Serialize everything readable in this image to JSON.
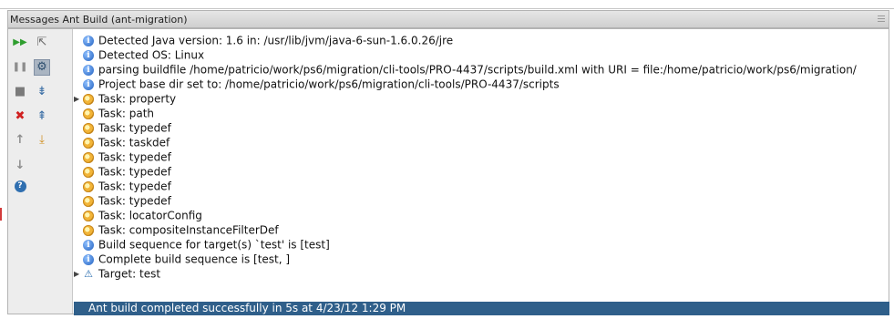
{
  "window": {
    "title": "Messages Ant Build (ant-migration)"
  },
  "toolbar": {
    "buttons": [
      {
        "name": "rerun-icon",
        "glyph": "▶▶",
        "color": "#2f9e2f"
      },
      {
        "name": "collapse-icon",
        "glyph": "⇱",
        "color": "#6b6b6b"
      },
      {
        "name": "pause-icon",
        "glyph": "❚❚",
        "color": "#8d8d8d"
      },
      {
        "name": "filter-icon",
        "glyph": "⚙",
        "color": "#2f4f6f"
      },
      {
        "name": "stop-icon",
        "glyph": "■",
        "color": "#7a7a7a"
      },
      {
        "name": "expand-all-icon",
        "glyph": "⇟",
        "color": "#3a6ea5"
      },
      {
        "name": "close-icon",
        "glyph": "✖",
        "color": "#d02020"
      },
      {
        "name": "collapse-all-icon",
        "glyph": "⇞",
        "color": "#3a6ea5"
      },
      {
        "name": "up-arrow-icon",
        "glyph": "↑",
        "color": "#8d8d8d"
      },
      {
        "name": "export-icon",
        "glyph": "⤓",
        "color": "#d08f20"
      },
      {
        "name": "down-arrow-icon",
        "glyph": "↓",
        "color": "#8d8d8d"
      },
      {
        "name": "help-icon",
        "glyph": "?",
        "color": "#2f6fb0"
      }
    ]
  },
  "messages": [
    {
      "type": "info",
      "text": "Detected Java version: 1.6 in: /usr/lib/jvm/java-6-sun-1.6.0.26/jre"
    },
    {
      "type": "info",
      "text": "Detected OS: Linux"
    },
    {
      "type": "info",
      "text": "parsing buildfile /home/patricio/work/ps6/migration/cli-tools/PRO-4437/scripts/build.xml with URI = file:/home/patricio/work/ps6/migration/"
    },
    {
      "type": "info",
      "text": "Project base dir set to: /home/patricio/work/ps6/migration/cli-tools/PRO-4437/scripts"
    },
    {
      "type": "task",
      "text": "Task: property",
      "expandable": true
    },
    {
      "type": "task",
      "text": "Task: path"
    },
    {
      "type": "task",
      "text": "Task: typedef"
    },
    {
      "type": "task",
      "text": "Task: taskdef"
    },
    {
      "type": "task",
      "text": "Task: typedef"
    },
    {
      "type": "task",
      "text": "Task: typedef"
    },
    {
      "type": "task",
      "text": "Task: typedef"
    },
    {
      "type": "task",
      "text": "Task: typedef"
    },
    {
      "type": "task",
      "text": "Task: locatorConfig"
    },
    {
      "type": "task",
      "text": "Task: compositeInstanceFilterDef"
    },
    {
      "type": "info",
      "text": "Build sequence for target(s) `test' is [test]"
    },
    {
      "type": "info",
      "text": "Complete build sequence is [test, ]"
    },
    {
      "type": "target",
      "text": "Target: test",
      "expandable": true
    }
  ],
  "status": {
    "text": "Ant build completed successfully in 5s at 4/23/12 1:29 PM",
    "background": "#2f5f8a"
  }
}
